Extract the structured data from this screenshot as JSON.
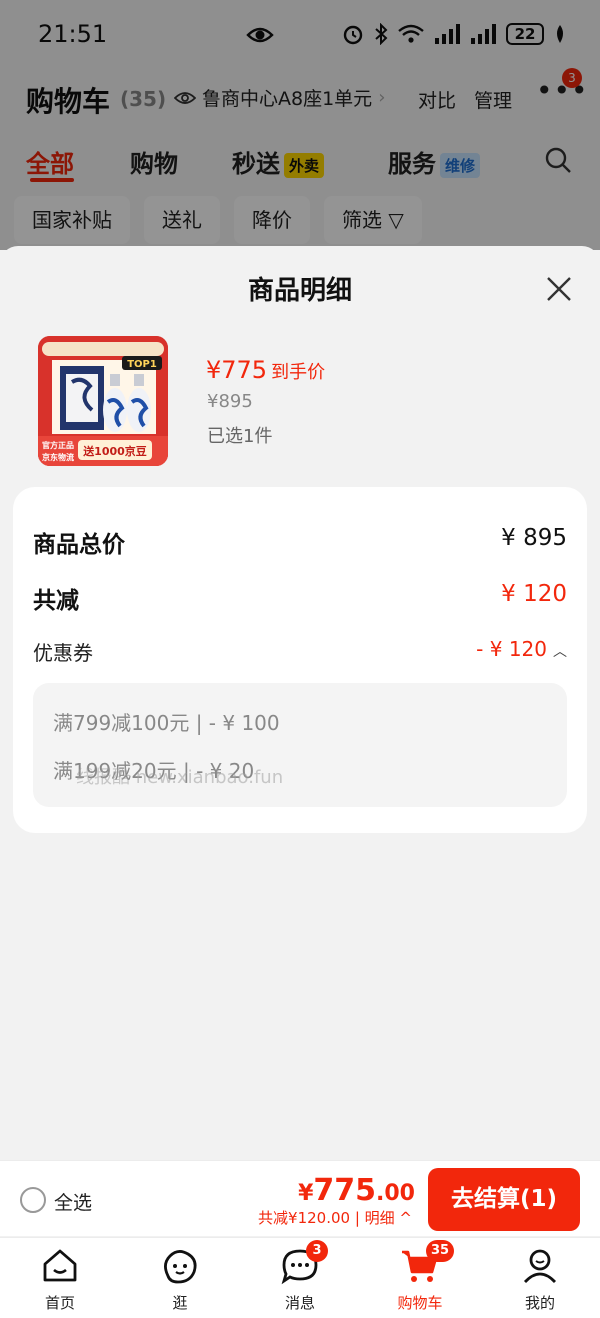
{
  "status_bar": {
    "time": "21:51",
    "battery": "22"
  },
  "cart_header": {
    "title": "购物车",
    "count": "(35)",
    "address": "鲁商中心A8座1单元",
    "compare_label": "对比",
    "manage_label": "管理",
    "more_badge": "3"
  },
  "tabs": [
    {
      "label": "全部"
    },
    {
      "label": "购物"
    },
    {
      "label": "秒送",
      "tag": "外卖"
    },
    {
      "label": "服务",
      "tag": "维修"
    }
  ],
  "filter_chips": [
    "国家补贴",
    "送礼",
    "降价",
    "筛选"
  ],
  "sheet": {
    "title": "商品明细",
    "product": {
      "price_now": "¥775",
      "price_now_label": "到手价",
      "price_original": "¥895",
      "selected": "已选1件",
      "image_texts": [
        "TOP1",
        "官方正品",
        "京东物流",
        "送1000京豆"
      ]
    },
    "summary": {
      "total_label": "商品总价",
      "total_value": "¥ 895",
      "discount_label": "共减",
      "discount_value": "¥ 120",
      "coupon_label": "优惠券",
      "coupon_value": "- ¥ 120",
      "coupon_lines": [
        "满799减100元 | - ¥ 100",
        "满199减20元 | - ¥ 20"
      ]
    },
    "watermark": "线报酷 new.xianbao.fun"
  },
  "checkout": {
    "select_all": "全选",
    "total_yen": "¥",
    "total_int": "775",
    "total_dec": ".00",
    "savings": "共减¥120.00 | 明细 ^",
    "button": "去结算(1)"
  },
  "tabbar": [
    {
      "label": "首页",
      "icon": "home-icon"
    },
    {
      "label": "逛",
      "icon": "explore-icon"
    },
    {
      "label": "消息",
      "icon": "message-icon",
      "badge": "3"
    },
    {
      "label": "购物车",
      "icon": "cart-icon",
      "badge": "35",
      "active": true
    },
    {
      "label": "我的",
      "icon": "profile-icon"
    }
  ],
  "colors": {
    "accent": "#f2270c",
    "sheet_bg": "#f2f2f2",
    "overlay": "rgba(0,0,0,0.42)"
  }
}
